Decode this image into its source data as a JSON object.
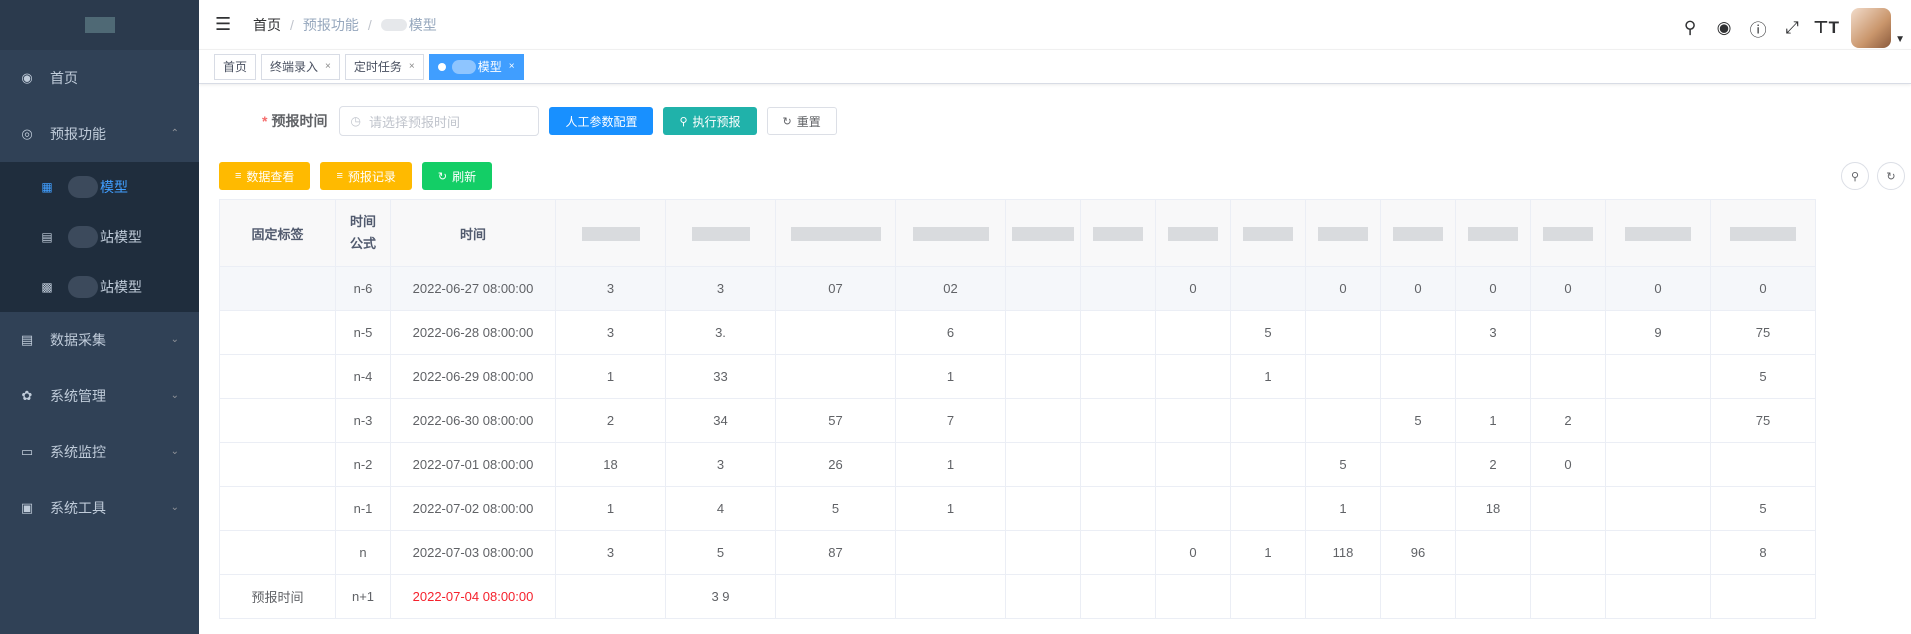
{
  "sidebar": {
    "items": [
      {
        "label": "首页",
        "icon": "dashboard-icon"
      },
      {
        "label": "预报功能",
        "icon": "eye-icon",
        "expanded": true
      },
      {
        "label": "数据采集",
        "icon": "document-icon"
      },
      {
        "label": "系统管理",
        "icon": "gear-icon"
      },
      {
        "label": "系统监控",
        "icon": "monitor-icon"
      },
      {
        "label": "系统工具",
        "icon": "toolbox-icon"
      }
    ],
    "sub_items": [
      {
        "label": "模型",
        "active": true
      },
      {
        "label": "站模型"
      },
      {
        "label": "站模型"
      }
    ]
  },
  "breadcrumb": {
    "home": "首页",
    "section": "预报功能",
    "current": "模型"
  },
  "tags": [
    {
      "label": "首页"
    },
    {
      "label": "终端录入"
    },
    {
      "label": "定时任务"
    },
    {
      "label": "模型",
      "active": true
    }
  ],
  "form": {
    "label": "预报时间",
    "required_mark": "*",
    "placeholder": "请选择预报时间",
    "btn_config": "人工参数配置",
    "btn_run": "执行预报",
    "btn_reset": "重置"
  },
  "toolbar": {
    "btn_view": "数据查看",
    "btn_records": "预报记录",
    "btn_refresh": "刷新"
  },
  "table": {
    "headers": [
      "固定标签",
      "时间\n公式",
      "时间"
    ],
    "rows": [
      {
        "label": "",
        "formula": "n-6",
        "time": "2022-06-27 08:00:00",
        "cells": [
          "3",
          "3",
          "07",
          "02",
          "",
          "",
          "0",
          "",
          "0",
          "0",
          "0",
          "0",
          "0",
          "0"
        ]
      },
      {
        "label": "",
        "formula": "n-5",
        "time": "2022-06-28 08:00:00",
        "cells": [
          "3",
          "3.",
          "",
          "6",
          "",
          "",
          "",
          "5",
          "",
          "",
          "3",
          "",
          "9",
          "75"
        ]
      },
      {
        "label": "",
        "formula": "n-4",
        "time": "2022-06-29 08:00:00",
        "cells": [
          "1",
          "33",
          "",
          "1",
          "",
          "",
          "",
          "1",
          "",
          "",
          "",
          "",
          "",
          "5"
        ]
      },
      {
        "label": "",
        "formula": "n-3",
        "time": "2022-06-30 08:00:00",
        "cells": [
          "2",
          "34",
          "57",
          "7",
          "",
          "",
          "",
          "",
          "",
          "5",
          "1",
          "2",
          "",
          "75"
        ]
      },
      {
        "label": "",
        "formula": "n-2",
        "time": "2022-07-01 08:00:00",
        "cells": [
          "18",
          "3",
          "26",
          "1",
          "",
          "",
          "",
          "",
          "5",
          "",
          "2",
          "0",
          "",
          ""
        ]
      },
      {
        "label": "",
        "formula": "n-1",
        "time": "2022-07-02 08:00:00",
        "cells": [
          "1",
          "4",
          "5",
          "1",
          "",
          "",
          "",
          "",
          "1",
          "",
          "18",
          "",
          "",
          "5"
        ]
      },
      {
        "label": "",
        "formula": "n",
        "time": "2022-07-03 08:00:00",
        "cells": [
          "3",
          "5",
          "87",
          "",
          "",
          "",
          "0",
          "1",
          "118",
          "96",
          "",
          "",
          "",
          "8"
        ]
      },
      {
        "label": "预报时间",
        "formula": "n+1",
        "time": "2022-07-04 08:00:00",
        "cells": [
          "",
          "3 9",
          "",
          "",
          "",
          "",
          "",
          "",
          "",
          "",
          "",
          "",
          "",
          ""
        ],
        "time_color": "#f5222d"
      }
    ]
  }
}
